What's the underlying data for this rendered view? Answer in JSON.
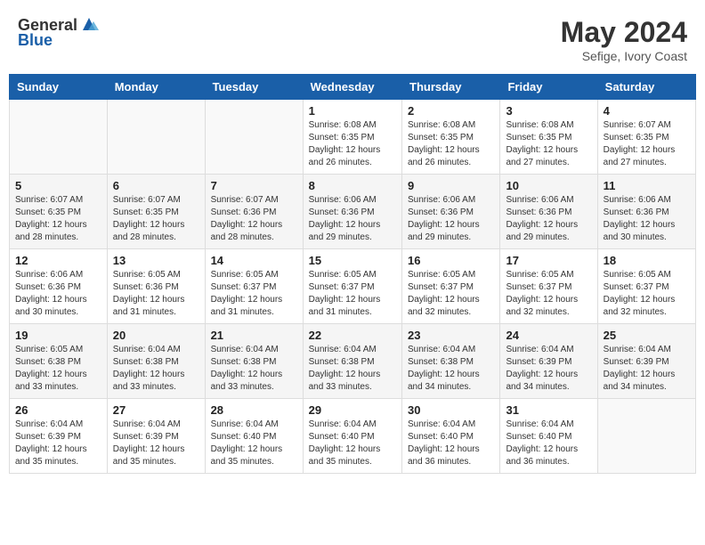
{
  "header": {
    "logo_general": "General",
    "logo_blue": "Blue",
    "month_year": "May 2024",
    "location": "Sefige, Ivory Coast"
  },
  "days_of_week": [
    "Sunday",
    "Monday",
    "Tuesday",
    "Wednesday",
    "Thursday",
    "Friday",
    "Saturday"
  ],
  "weeks": [
    [
      {
        "day": "",
        "info": ""
      },
      {
        "day": "",
        "info": ""
      },
      {
        "day": "",
        "info": ""
      },
      {
        "day": "1",
        "info": "Sunrise: 6:08 AM\nSunset: 6:35 PM\nDaylight: 12 hours\nand 26 minutes."
      },
      {
        "day": "2",
        "info": "Sunrise: 6:08 AM\nSunset: 6:35 PM\nDaylight: 12 hours\nand 26 minutes."
      },
      {
        "day": "3",
        "info": "Sunrise: 6:08 AM\nSunset: 6:35 PM\nDaylight: 12 hours\nand 27 minutes."
      },
      {
        "day": "4",
        "info": "Sunrise: 6:07 AM\nSunset: 6:35 PM\nDaylight: 12 hours\nand 27 minutes."
      }
    ],
    [
      {
        "day": "5",
        "info": "Sunrise: 6:07 AM\nSunset: 6:35 PM\nDaylight: 12 hours\nand 28 minutes."
      },
      {
        "day": "6",
        "info": "Sunrise: 6:07 AM\nSunset: 6:35 PM\nDaylight: 12 hours\nand 28 minutes."
      },
      {
        "day": "7",
        "info": "Sunrise: 6:07 AM\nSunset: 6:36 PM\nDaylight: 12 hours\nand 28 minutes."
      },
      {
        "day": "8",
        "info": "Sunrise: 6:06 AM\nSunset: 6:36 PM\nDaylight: 12 hours\nand 29 minutes."
      },
      {
        "day": "9",
        "info": "Sunrise: 6:06 AM\nSunset: 6:36 PM\nDaylight: 12 hours\nand 29 minutes."
      },
      {
        "day": "10",
        "info": "Sunrise: 6:06 AM\nSunset: 6:36 PM\nDaylight: 12 hours\nand 29 minutes."
      },
      {
        "day": "11",
        "info": "Sunrise: 6:06 AM\nSunset: 6:36 PM\nDaylight: 12 hours\nand 30 minutes."
      }
    ],
    [
      {
        "day": "12",
        "info": "Sunrise: 6:06 AM\nSunset: 6:36 PM\nDaylight: 12 hours\nand 30 minutes."
      },
      {
        "day": "13",
        "info": "Sunrise: 6:05 AM\nSunset: 6:36 PM\nDaylight: 12 hours\nand 31 minutes."
      },
      {
        "day": "14",
        "info": "Sunrise: 6:05 AM\nSunset: 6:37 PM\nDaylight: 12 hours\nand 31 minutes."
      },
      {
        "day": "15",
        "info": "Sunrise: 6:05 AM\nSunset: 6:37 PM\nDaylight: 12 hours\nand 31 minutes."
      },
      {
        "day": "16",
        "info": "Sunrise: 6:05 AM\nSunset: 6:37 PM\nDaylight: 12 hours\nand 32 minutes."
      },
      {
        "day": "17",
        "info": "Sunrise: 6:05 AM\nSunset: 6:37 PM\nDaylight: 12 hours\nand 32 minutes."
      },
      {
        "day": "18",
        "info": "Sunrise: 6:05 AM\nSunset: 6:37 PM\nDaylight: 12 hours\nand 32 minutes."
      }
    ],
    [
      {
        "day": "19",
        "info": "Sunrise: 6:05 AM\nSunset: 6:38 PM\nDaylight: 12 hours\nand 33 minutes."
      },
      {
        "day": "20",
        "info": "Sunrise: 6:04 AM\nSunset: 6:38 PM\nDaylight: 12 hours\nand 33 minutes."
      },
      {
        "day": "21",
        "info": "Sunrise: 6:04 AM\nSunset: 6:38 PM\nDaylight: 12 hours\nand 33 minutes."
      },
      {
        "day": "22",
        "info": "Sunrise: 6:04 AM\nSunset: 6:38 PM\nDaylight: 12 hours\nand 33 minutes."
      },
      {
        "day": "23",
        "info": "Sunrise: 6:04 AM\nSunset: 6:38 PM\nDaylight: 12 hours\nand 34 minutes."
      },
      {
        "day": "24",
        "info": "Sunrise: 6:04 AM\nSunset: 6:39 PM\nDaylight: 12 hours\nand 34 minutes."
      },
      {
        "day": "25",
        "info": "Sunrise: 6:04 AM\nSunset: 6:39 PM\nDaylight: 12 hours\nand 34 minutes."
      }
    ],
    [
      {
        "day": "26",
        "info": "Sunrise: 6:04 AM\nSunset: 6:39 PM\nDaylight: 12 hours\nand 35 minutes."
      },
      {
        "day": "27",
        "info": "Sunrise: 6:04 AM\nSunset: 6:39 PM\nDaylight: 12 hours\nand 35 minutes."
      },
      {
        "day": "28",
        "info": "Sunrise: 6:04 AM\nSunset: 6:40 PM\nDaylight: 12 hours\nand 35 minutes."
      },
      {
        "day": "29",
        "info": "Sunrise: 6:04 AM\nSunset: 6:40 PM\nDaylight: 12 hours\nand 35 minutes."
      },
      {
        "day": "30",
        "info": "Sunrise: 6:04 AM\nSunset: 6:40 PM\nDaylight: 12 hours\nand 36 minutes."
      },
      {
        "day": "31",
        "info": "Sunrise: 6:04 AM\nSunset: 6:40 PM\nDaylight: 12 hours\nand 36 minutes."
      },
      {
        "day": "",
        "info": ""
      }
    ]
  ]
}
